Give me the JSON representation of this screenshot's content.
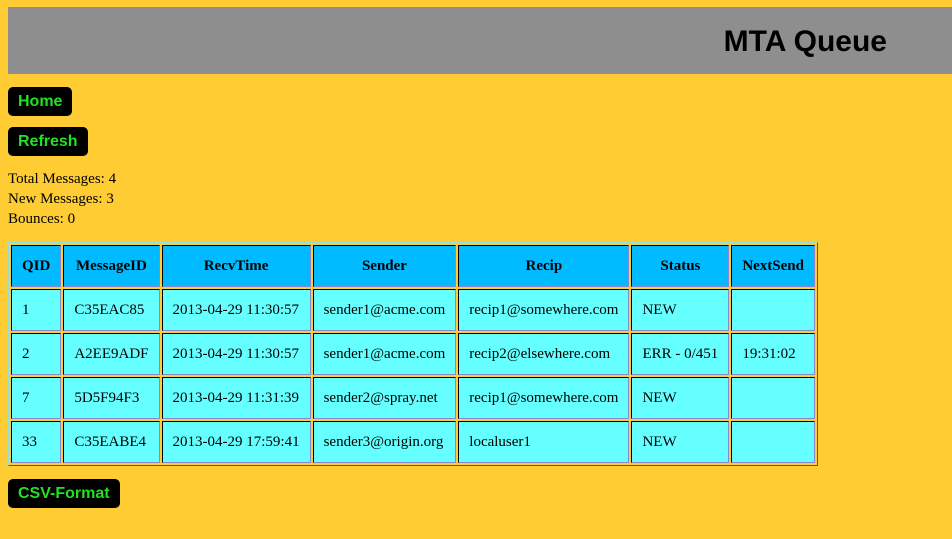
{
  "header": {
    "title": "MTA Queue"
  },
  "nav": {
    "home_label": "Home",
    "refresh_label": "Refresh",
    "csv_label": "CSV-Format"
  },
  "stats": {
    "total": "Total Messages: 4",
    "new": "New Messages: 3",
    "bounces": "Bounces: 0"
  },
  "colors": {
    "background": "#ffcc33",
    "header": "#8e8e8e",
    "button_bg": "#000000",
    "button_text": "#22e022",
    "th_bg": "#00bbff",
    "td_bg": "#66ffff"
  },
  "table": {
    "columns": [
      "QID",
      "MessageID",
      "RecvTime",
      "Sender",
      "Recip",
      "Status",
      "NextSend"
    ],
    "rows": [
      [
        "1",
        "C35EAC85",
        "2013-04-29 11:30:57",
        "sender1@acme.com",
        "recip1@somewhere.com",
        "NEW",
        ""
      ],
      [
        "2",
        "A2EE9ADF",
        "2013-04-29 11:30:57",
        "sender1@acme.com",
        "recip2@elsewhere.com",
        "ERR - 0/451",
        "19:31:02"
      ],
      [
        "7",
        "5D5F94F3",
        "2013-04-29 11:31:39",
        "sender2@spray.net",
        "recip1@somewhere.com",
        "NEW",
        ""
      ],
      [
        "33",
        "C35EABE4",
        "2013-04-29 17:59:41",
        "sender3@origin.org",
        "localuser1",
        "NEW",
        ""
      ]
    ]
  }
}
